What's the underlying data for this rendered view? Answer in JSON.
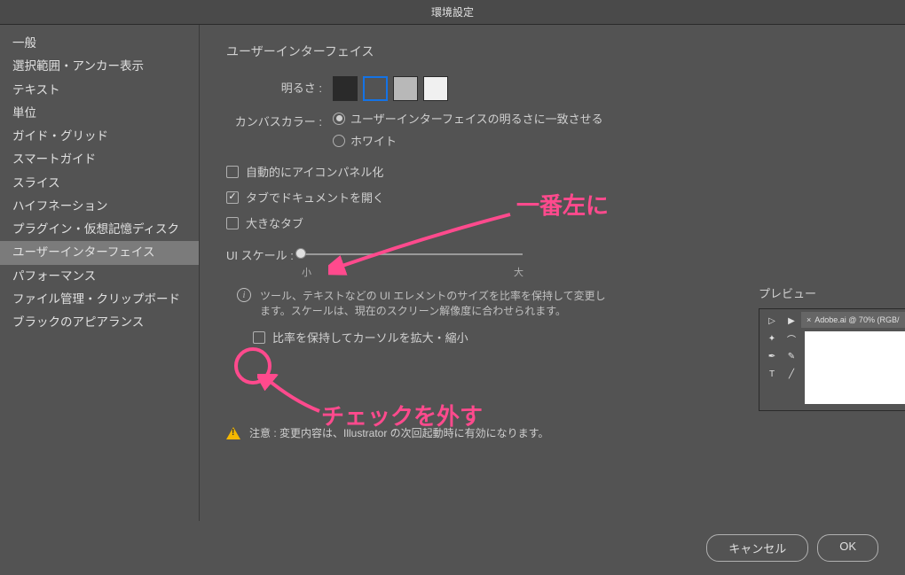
{
  "window": {
    "title": "環境設定"
  },
  "sidebar": {
    "items": [
      "一般",
      "選択範囲・アンカー表示",
      "テキスト",
      "単位",
      "ガイド・グリッド",
      "スマートガイド",
      "スライス",
      "ハイフネーション",
      "プラグイン・仮想記憶ディスク",
      "ユーザーインターフェイス",
      "パフォーマンス",
      "ファイル管理・クリップボード",
      "ブラックのアピアランス"
    ],
    "selected_index": 9
  },
  "panel": {
    "title": "ユーザーインターフェイス",
    "brightness": {
      "label": "明るさ :",
      "selected_index": 1,
      "swatches": [
        "#2a2a2a",
        "#535353",
        "#b8b8b8",
        "#f0f0f0"
      ]
    },
    "canvas_color": {
      "label": "カンバスカラー :",
      "options": [
        "ユーザーインターフェイスの明るさに一致させる",
        "ホワイト"
      ],
      "selected_index": 0
    },
    "checkboxes": {
      "auto_icon": {
        "label": "自動的にアイコンパネル化",
        "checked": false
      },
      "tab_open": {
        "label": "タブでドキュメントを開く",
        "checked": true
      },
      "large_tabs": {
        "label": "大きなタブ",
        "checked": false
      },
      "scale_cursor": {
        "label": "比率を保持してカーソルを拡大・縮小",
        "checked": false
      }
    },
    "ui_scale": {
      "label": "UI スケール :",
      "min_label": "小",
      "max_label": "大",
      "info": "ツール、テキストなどの UI エレメントのサイズを比率を保持して変更します。スケールは、現在のスクリーン解像度に合わせられます。"
    },
    "preview": {
      "label": "プレビュー",
      "tab_label": "Adobe.ai @ 70% (RGB/"
    },
    "warning": "注意 : 変更内容は、Illustrator の次回起動時に有効になります。"
  },
  "footer": {
    "cancel": "キャンセル",
    "ok": "OK"
  },
  "annotations": {
    "leftmost": "一番左に",
    "uncheck": "チェックを外す"
  }
}
